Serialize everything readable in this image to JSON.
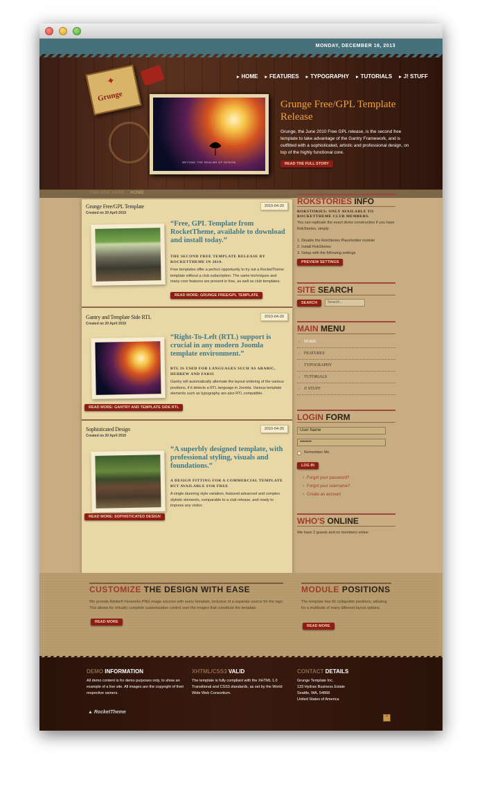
{
  "window": {
    "buttons": [
      "close",
      "minimize",
      "zoom"
    ]
  },
  "header": {
    "date": "MONDAY, DECEMBER 16, 2013",
    "nav": [
      "HOME",
      "FEATURES",
      "TYPOGRAPHY",
      "TUTORIALS",
      "J! STUFF"
    ],
    "logo_text": "Grunge",
    "featured": {
      "title": "Grunge Free/GPL Template Release",
      "caption": "BEYOND THE REALMS OF DESIGN",
      "description": "Grunge, the June 2010 Free GPL release, is the second free template to take advantage of the Gantry Framework, and is outfitted with a sophisticated, artistic and professional design, on top of the highly functional core.",
      "button": "READ THE FULL STORY"
    }
  },
  "breadcrumb": {
    "prefix": "YOU ARE HERE:",
    "current": "HOME"
  },
  "articles": [
    {
      "title": "Grunge Free/GPL Template",
      "created": "Created on 20 April 2010",
      "date_tag": "2010-04-20",
      "quote": "“Free, GPL Template from RocketTheme, available to download and install today.”",
      "subtitle": "THE SECOND FREE TEMPLATE RELEASE BY ROCKETTHEME IN 2010.",
      "body": "Free templates offer a perfect opportunity to try out a RocketTheme template without a club subscription. The same techniques and many core features are present in free, as well as club templates.",
      "button": "READ MORE: GRUNGE FREE/GPL TEMPLATE"
    },
    {
      "title": "Gantry and Template Side RTL",
      "created": "Created on 20 April 2010",
      "date_tag": "2010-04-20",
      "quote": "“Right-To-Left (RTL) support is crucial in any modern Joomla template environment.”",
      "subtitle": "RTL IS USED FOR LANGUAGES SUCH AS ARABIC, HEBREW AND FARSI",
      "body": "Gantry will automatically alternate the layout ordering of the various positions, if it detects a RTL language in Joomla. Various template elements such as typography are also RTL compatible.",
      "button": "READ MORE: GANTRY AND TEMPLATE SIDE RTL"
    },
    {
      "title": "Sophisticated Design",
      "created": "Created on 20 April 2010",
      "date_tag": "2010-04-20",
      "quote": "“A superbly designed template, with professional styling, visuals and foundations.”",
      "subtitle": "A DESIGN FITTING FOR A COMMERCIAL TEMPLATE BUT AVAILABLE FOR FREE",
      "body": "A single stunning style variation, featured advanced and complex stylistic elements, comparable to a club release, and ready to impress any visitor.",
      "button": "READ MORE: SOPHISTICATED DESIGN"
    }
  ],
  "sidebar": {
    "rokstories": {
      "title_a": "ROKSTORIES",
      "title_b": "INFO",
      "subtitle": "ROKSTORIES: ONLY AVAILABLE TO ROCKETTHEME CLUB MEMBERS.",
      "text": "You can replicate the exact demo construction if you have RokStories, simply:",
      "steps": [
        "1. Disable the RokStories Placeholder module",
        "2. Install RokStories",
        "3. Setup with the following settings"
      ],
      "button": "PREVIEW SETTINGS"
    },
    "search": {
      "title_a": "SITE",
      "title_b": "SEARCH",
      "button": "SEARCH",
      "placeholder": "Search..."
    },
    "menu": {
      "title_a": "MAIN",
      "title_b": "MENU",
      "items": [
        "HOME",
        "FEATURES",
        "TYPOGRAPHY",
        "TUTORIALS",
        "J! STUFF"
      ]
    },
    "login": {
      "title_a": "LOGIN",
      "title_b": "FORM",
      "username": "User Name",
      "password": "••••••••",
      "remember": "Remember Me",
      "button": "LOG IN",
      "links": [
        "Forgot your password?",
        "Forgot your username?",
        "Create an account"
      ]
    },
    "online": {
      "title_a": "WHO'S",
      "title_b": "ONLINE",
      "text": "We have 2 guests and no members online"
    }
  },
  "bottom": {
    "customize": {
      "title_a": "CUSTOMIZE",
      "title_b": "THE DESIGN WITH EASE",
      "text": "We provide Adobe® Fireworks PNG image sources with every template, inclusive of a separate source for the logo. This allows for virtually complete customization control over the images that constitute the template.",
      "button": "READ MORE"
    },
    "module": {
      "title_a": "MODULE",
      "title_b": "POSITIONS",
      "text": "The template has 66 collapsible positions, allowing for a multitude of many different layout options.",
      "button": "READ MORE"
    }
  },
  "footer": {
    "demo": {
      "title_a": "DEMO",
      "title_b": "INFORMATION",
      "text": "All demo content is for demo purposes only, to show an example of a live site. All images are the copyright of their respective owners."
    },
    "valid": {
      "title_a": "XHTML/CSS3",
      "title_b": "VALID",
      "text": "The template is fully compliant with the XHTML 1.0 Transitional and CSS3 standards, as set by the World Wide Web Consortium."
    },
    "contact": {
      "title_a": "CONTACT",
      "title_b": "DETAILS",
      "lines": [
        "Grunge Template Inc.",
        "133 Hydrax Business Estate",
        "Seattle, WA, 54868",
        "United States of America"
      ]
    },
    "brand": "RocketTheme"
  }
}
